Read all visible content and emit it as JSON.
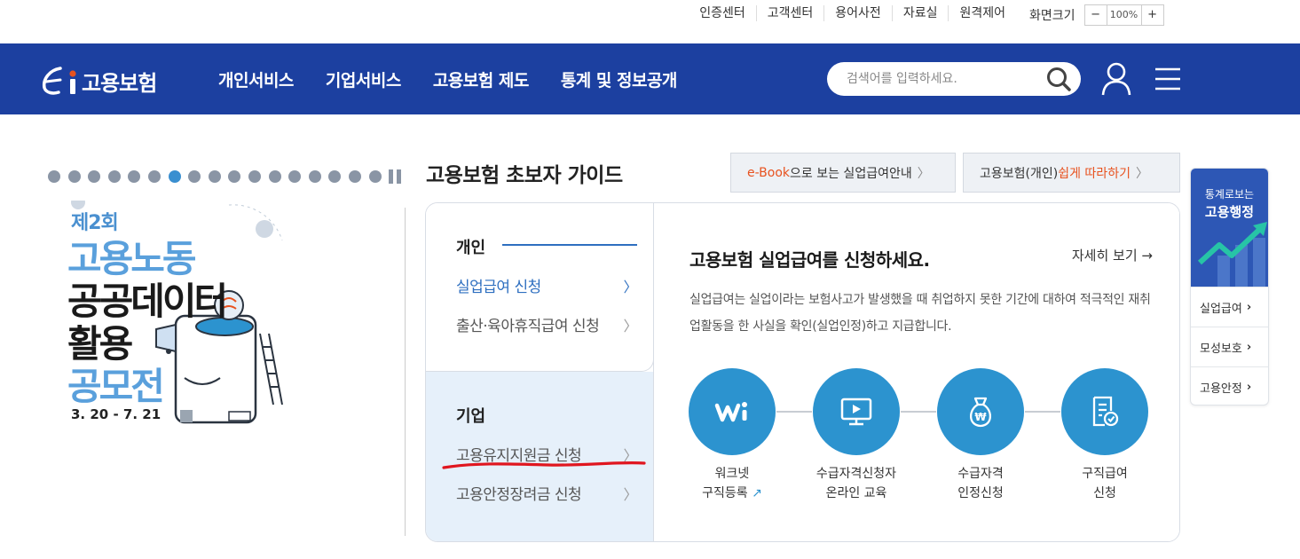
{
  "utility": {
    "links": [
      "인증센터",
      "고객센터",
      "용어사전",
      "자료실"
    ],
    "remote": "원격제어",
    "zoom_label": "화면크기",
    "zoom_minus": "−",
    "zoom_value": "100%",
    "zoom_plus": "+"
  },
  "header": {
    "logo_text": "고용보험",
    "nav": [
      "개인서비스",
      "기업서비스",
      "고용보험 제도",
      "통계 및 정보공개"
    ],
    "search_placeholder": "검색어를 입력하세요."
  },
  "banner": {
    "round": "제2회",
    "line1": "고용노동",
    "line2": "공공데이터",
    "line3": "활용",
    "line4": "공모전",
    "date": "3. 20 - 7. 21",
    "slide_count": 17,
    "active_slide": 7
  },
  "guide": {
    "title": "고용보험 초보자 가이드",
    "btn1_hl": "e-Book",
    "btn1_rest": "으로 보는 실업급여안내",
    "btn2_pre": "고용보험(개인) ",
    "btn2_hl": "쉽게 따라하기",
    "individual_label": "개인",
    "individual_items": [
      "실업급여 신청",
      "출산·육아휴직급여 신청"
    ],
    "corporate_label": "기업",
    "corporate_items": [
      "고용유지지원금 신청",
      "고용안정장려금 신청"
    ]
  },
  "content": {
    "title": "고용보험 실업급여를 신청하세요.",
    "more": "자세히 보기",
    "desc": "실업급여는 실업이라는 보험사고가 발생했을 때 취업하지 못한 기간에 대하여 적극적인 재취업활동을 한 사실을 확인(실업인정)하고 지급합니다.",
    "steps": [
      {
        "l1": "워크넷",
        "l2": "구직등록"
      },
      {
        "l1": "수급자격신청자",
        "l2": "온라인 교육"
      },
      {
        "l1": "수급자격",
        "l2": "인정신청"
      },
      {
        "l1": "구직급여",
        "l2": "신청"
      }
    ]
  },
  "quick": {
    "t1": "통계로보는",
    "t2": "고용행정",
    "items": [
      "실업급여",
      "모성보호",
      "고용안정"
    ]
  },
  "colors": {
    "header_blue": "#1c40a0",
    "accent_blue": "#2c93cf",
    "highlight_orange": "#e8521f"
  }
}
